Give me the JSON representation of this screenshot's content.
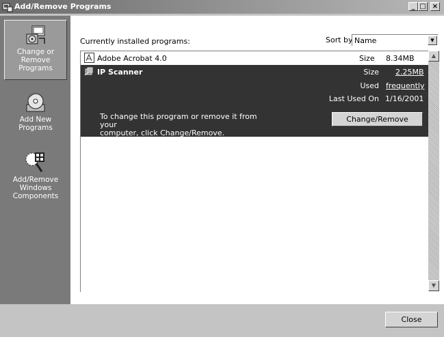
{
  "window": {
    "title": "Add/Remove Programs",
    "min_label": "_",
    "max_label": "□",
    "close_label": "×"
  },
  "sidebar": {
    "items": [
      {
        "label_lines": [
          "Change or",
          "Remove",
          "Programs"
        ],
        "icon": "change-remove-icon",
        "active": true
      },
      {
        "label_lines": [
          "Add New",
          "Programs"
        ],
        "icon": "cd-box-icon",
        "active": false
      },
      {
        "label_lines": [
          "Add/Remove",
          "Windows",
          "Components"
        ],
        "icon": "windows-components-icon",
        "active": false
      }
    ]
  },
  "main": {
    "installed_label": "Currently installed programs:",
    "sort_by_label": "Sort by:",
    "sort_by_value": "Name"
  },
  "programs": [
    {
      "name": "Adobe Acrobat 4.0",
      "size_label": "Size",
      "size_value": "8.34MB",
      "icon": "acrobat-icon",
      "selected": false
    },
    {
      "name": "IP Scanner",
      "size_label": "Size",
      "size_value": "2.25MB",
      "used_label": "Used",
      "used_value": "frequently",
      "last_used_label": "Last Used On",
      "last_used_value": "1/16/2001",
      "hint_line1": "To change this program or remove it from your",
      "hint_line2": "computer, click Change/Remove.",
      "button_label": "Change/Remove",
      "icon": "ip-scanner-icon",
      "selected": true
    }
  ],
  "footer": {
    "close_label": "Close"
  },
  "colors": {
    "sidebar_bg": "#7a7a7a",
    "selected_row_bg": "#333333",
    "title_bar": "#6a6a6a"
  }
}
